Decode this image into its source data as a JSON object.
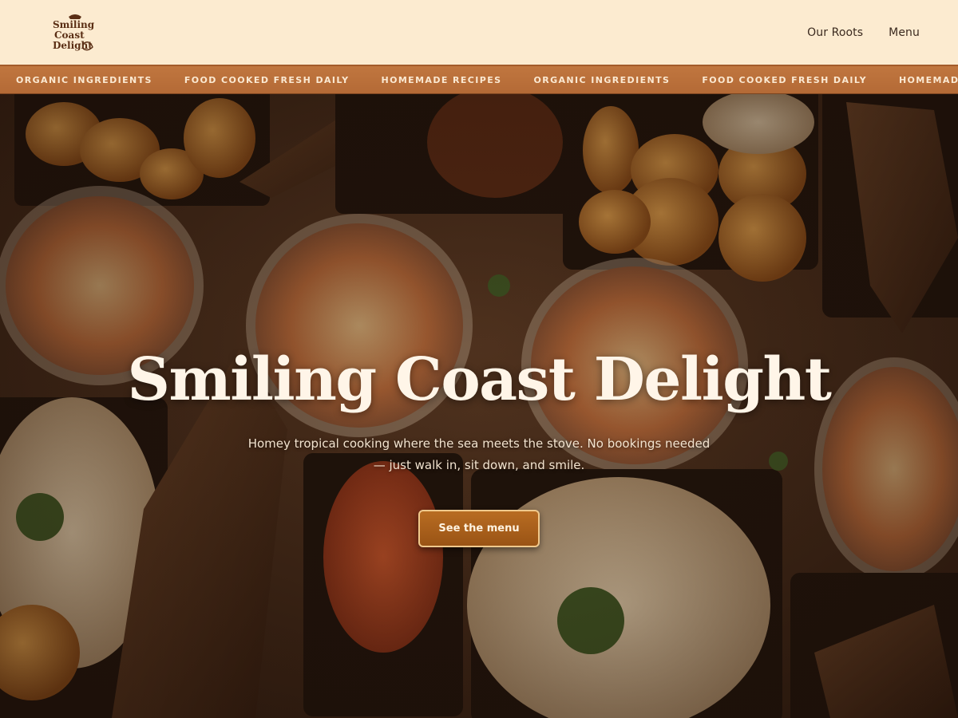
{
  "brand": {
    "logo_text": [
      "Smiling",
      "Coast",
      "Delight"
    ],
    "logo_color": "#5a2e14"
  },
  "nav": {
    "items": [
      {
        "label": "Our Roots"
      },
      {
        "label": "Menu"
      }
    ]
  },
  "ticker": {
    "items": [
      "ORGANIC INGREDIENTS",
      "FOOD COOKED FRESH DAILY",
      "HOMEMADE RECIPES",
      "ORGANIC INGREDIENTS",
      "FOOD COOKED FRESH DAILY",
      "HOMEMADE RECIPES"
    ]
  },
  "hero": {
    "title": "Smiling Coast Delight",
    "subtitle": "Homey tropical cooking where the sea meets the stove. No bookings needed — just walk in, sit down, and smile.",
    "cta_label": "See the menu"
  },
  "colors": {
    "header_bg": "#fcebd0",
    "ticker_bg": "#b86e3a",
    "cta_bg": "#a95f1b",
    "title_color": "#fff5e8"
  }
}
